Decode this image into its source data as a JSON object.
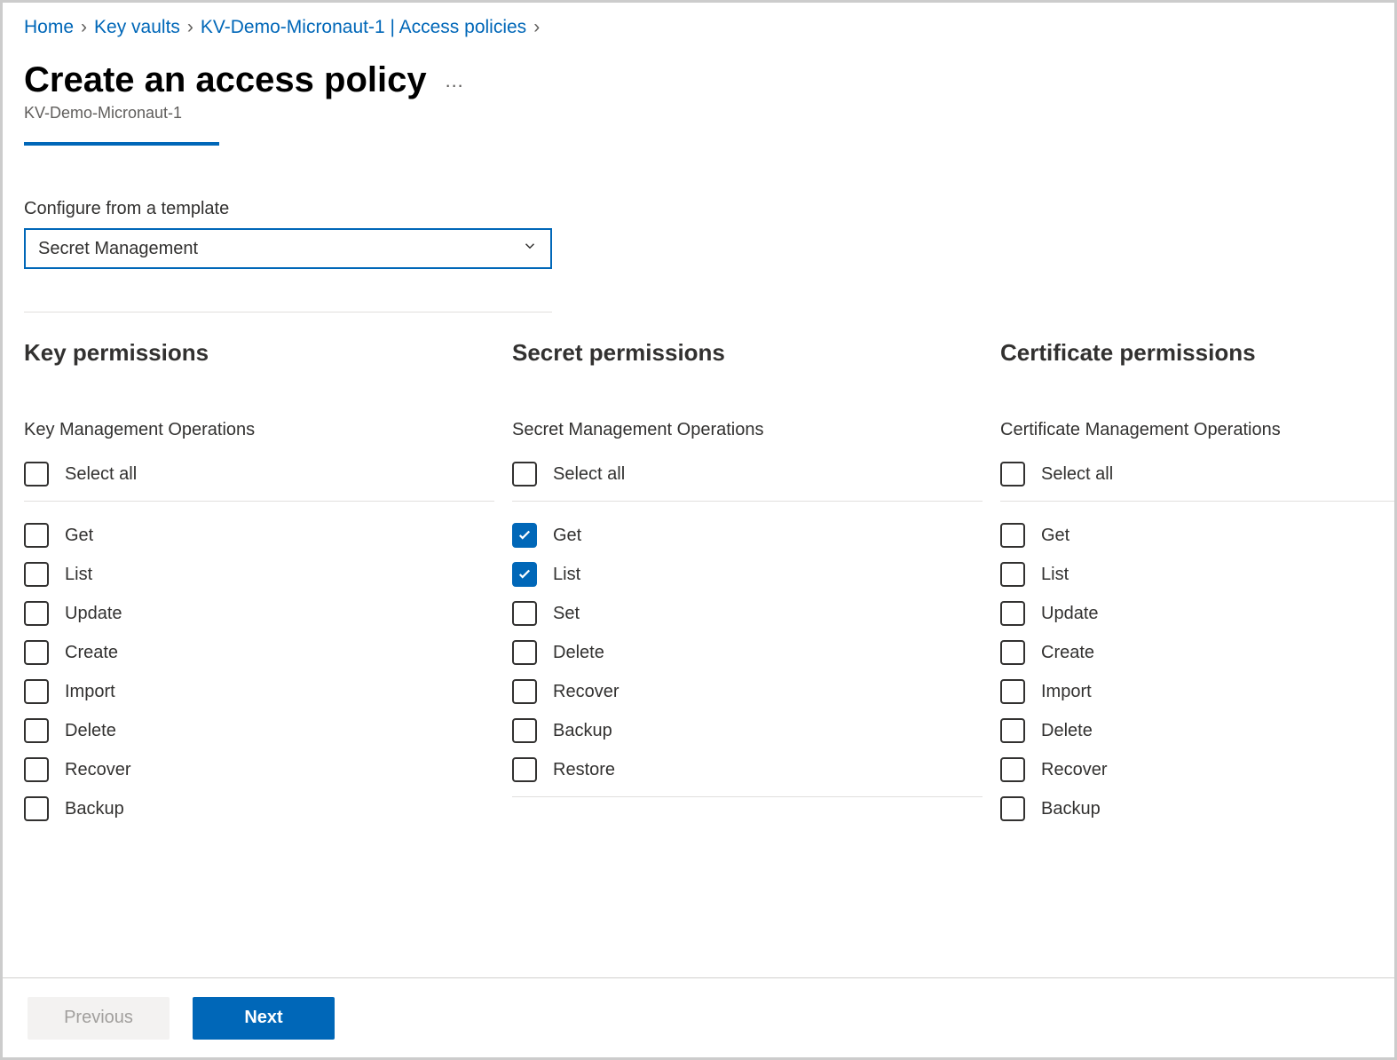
{
  "breadcrumb": {
    "home": "Home",
    "keyvaults": "Key vaults",
    "vaultpage": "KV-Demo-Micronaut-1 | Access policies"
  },
  "title": "Create an access policy",
  "subtitle": "KV-Demo-Micronaut-1",
  "template_label": "Configure from a template",
  "template_selected": "Secret Management",
  "columns": {
    "key": {
      "heading": "Key permissions",
      "subheading": "Key Management Operations",
      "select_all": "Select all",
      "items": [
        {
          "label": "Get",
          "checked": false
        },
        {
          "label": "List",
          "checked": false
        },
        {
          "label": "Update",
          "checked": false
        },
        {
          "label": "Create",
          "checked": false
        },
        {
          "label": "Import",
          "checked": false
        },
        {
          "label": "Delete",
          "checked": false
        },
        {
          "label": "Recover",
          "checked": false
        },
        {
          "label": "Backup",
          "checked": false
        }
      ]
    },
    "secret": {
      "heading": "Secret permissions",
      "subheading": "Secret Management Operations",
      "select_all": "Select all",
      "items": [
        {
          "label": "Get",
          "checked": true
        },
        {
          "label": "List",
          "checked": true
        },
        {
          "label": "Set",
          "checked": false
        },
        {
          "label": "Delete",
          "checked": false
        },
        {
          "label": "Recover",
          "checked": false
        },
        {
          "label": "Backup",
          "checked": false
        },
        {
          "label": "Restore",
          "checked": false
        }
      ]
    },
    "certificate": {
      "heading": "Certificate permissions",
      "subheading": "Certificate Management Operations",
      "select_all": "Select all",
      "items": [
        {
          "label": "Get",
          "checked": false
        },
        {
          "label": "List",
          "checked": false
        },
        {
          "label": "Update",
          "checked": false
        },
        {
          "label": "Create",
          "checked": false
        },
        {
          "label": "Import",
          "checked": false
        },
        {
          "label": "Delete",
          "checked": false
        },
        {
          "label": "Recover",
          "checked": false
        },
        {
          "label": "Backup",
          "checked": false
        }
      ]
    }
  },
  "footer": {
    "previous": "Previous",
    "next": "Next"
  }
}
